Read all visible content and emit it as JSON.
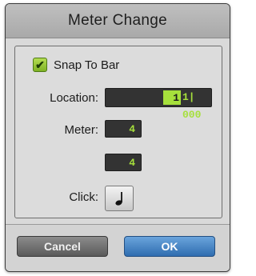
{
  "dialog": {
    "title": "Meter Change",
    "snap_to_bar": {
      "label": "Snap To Bar",
      "checked": true,
      "check_glyph": "✔"
    },
    "location": {
      "label": "Location:",
      "bar": "1",
      "beat_tick": "1| 000"
    },
    "meter": {
      "label": "Meter:",
      "numerator": "4",
      "denominator": "4"
    },
    "click": {
      "label": "Click:",
      "icon": "quarter-note-icon"
    },
    "buttons": {
      "cancel": "Cancel",
      "ok": "OK"
    }
  },
  "colors": {
    "accent_green": "#a6e03c",
    "field_bg": "#333333",
    "ok_blue": "#2f6db0",
    "cancel_gray": "#5a5a5a"
  }
}
